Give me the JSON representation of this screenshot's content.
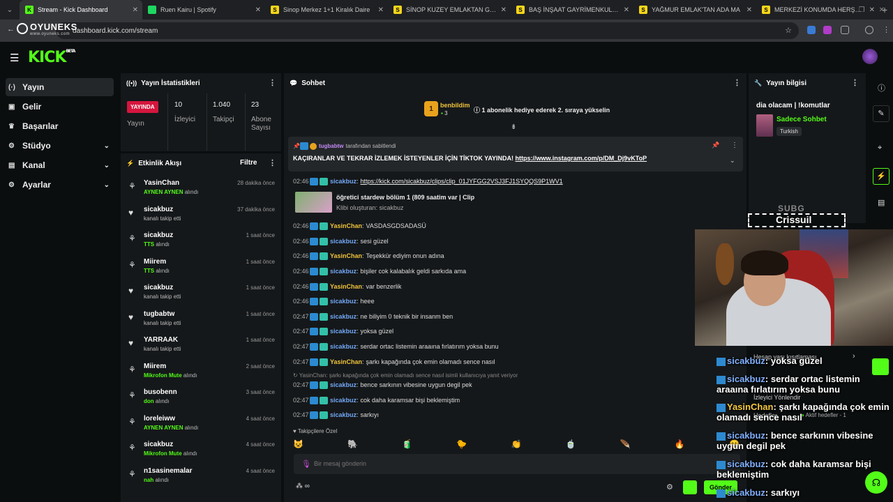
{
  "browser": {
    "tabs": [
      {
        "label": "Stream - Kick Dashboard",
        "color": "#53fc18",
        "glyph": "K",
        "active": true
      },
      {
        "label": "Ruen Kairu | Spotify",
        "color": "#1ed760",
        "glyph": "",
        "active": false
      },
      {
        "label": "Sinop Merkez 1+1 Kiralık Daire",
        "color": "#f5d51a",
        "glyph": "S",
        "active": false
      },
      {
        "label": "SİNOP KUZEY EMLAKTAN GELİ",
        "color": "#f5d51a",
        "glyph": "S",
        "active": false
      },
      {
        "label": "BAŞ İNŞAAT GAYRİMENKUL'DE",
        "color": "#f5d51a",
        "glyph": "S",
        "active": false
      },
      {
        "label": "YAĞMUR EMLAK'TAN ADA MA",
        "color": "#f5d51a",
        "glyph": "S",
        "active": false
      },
      {
        "label": "MERKEZİ KONUMDA HERŞEY D",
        "color": "#f5d51a",
        "glyph": "S",
        "active": false
      }
    ],
    "url": "dashboard.kick.com/stream",
    "overlay_logo": "OYUNEKS",
    "overlay_logo_sub": "www.oyuneks.com"
  },
  "sidebar": {
    "items": [
      {
        "label": "Yayın",
        "icon": "broadcast-icon",
        "glyph": "(·)",
        "active": true,
        "chevron": false
      },
      {
        "label": "Gelir",
        "icon": "wallet-icon",
        "glyph": "▣",
        "active": false,
        "chevron": false
      },
      {
        "label": "Başarılar",
        "icon": "trophy-icon",
        "glyph": "♛",
        "active": false,
        "chevron": false
      },
      {
        "label": "Stüdyo",
        "icon": "studio-icon",
        "glyph": "⚙",
        "active": false,
        "chevron": true
      },
      {
        "label": "Kanal",
        "icon": "channel-icon",
        "glyph": "▤",
        "active": false,
        "chevron": true
      },
      {
        "label": "Ayarlar",
        "icon": "settings-icon",
        "glyph": "⚙",
        "active": false,
        "chevron": true
      }
    ]
  },
  "stats": {
    "title": "Yayın İstatistikleri",
    "live_badge": "YAYINDA",
    "yayin_label": "Yayın",
    "viewers_value": "10",
    "viewers_label": "İzleyici",
    "followers_value": "1.040",
    "followers_label": "Takipçi",
    "subs_value": "23",
    "subs_label": "Abone Sayısı"
  },
  "activity": {
    "title": "Etkinlik Akışı",
    "filter_label": "Filtre",
    "items": [
      {
        "name": "YasinChan",
        "detail_highlight": "AYNEN AYNEN",
        "detail": " alındı",
        "time": "28 dakika önce",
        "icon": "reward-icon"
      },
      {
        "name": "sicakbuz",
        "detail_highlight": "",
        "detail": "kanalı takip etti",
        "time": "37 dakika önce",
        "icon": "heart-icon"
      },
      {
        "name": "sicakbuz",
        "detail_highlight": "TTS",
        "detail": " alındı",
        "time": "1 saat önce",
        "icon": "reward-icon"
      },
      {
        "name": "Miirem",
        "detail_highlight": "TTS",
        "detail": " alındı",
        "time": "1 saat önce",
        "icon": "reward-icon"
      },
      {
        "name": "sicakbuz",
        "detail_highlight": "",
        "detail": "kanalı takip etti",
        "time": "1 saat önce",
        "icon": "heart-icon"
      },
      {
        "name": "tugbabtw",
        "detail_highlight": "",
        "detail": "kanalı takip etti",
        "time": "1 saat önce",
        "icon": "heart-icon"
      },
      {
        "name": "YARRAAK",
        "detail_highlight": "",
        "detail": "kanalı takip etti",
        "time": "1 saat önce",
        "icon": "heart-icon"
      },
      {
        "name": "Miirem",
        "detail_highlight": "Mikrofon Mute",
        "detail": " alındı",
        "time": "2 saat önce",
        "icon": "reward-icon"
      },
      {
        "name": "busobenn",
        "detail_highlight": "don",
        "detail": " alındı",
        "time": "3 saat önce",
        "icon": "reward-icon"
      },
      {
        "name": "loreleiww",
        "detail_highlight": "AYNEN AYNEN",
        "detail": " alındı",
        "time": "4 saat önce",
        "icon": "reward-icon"
      },
      {
        "name": "sicakbuz",
        "detail_highlight": "Mikrofon Mute",
        "detail": " alındı",
        "time": "4 saat önce",
        "icon": "reward-icon"
      },
      {
        "name": "n1sasinemalar",
        "detail_highlight": "nah",
        "detail": " alındı",
        "time": "4 saat önce",
        "icon": "reward-icon"
      }
    ]
  },
  "chat": {
    "title": "Sohbet",
    "leader_name": "benbildim",
    "leader_count": "3",
    "leader_msg": "1 abonelik hediye ederek 2. sıraya yükselin",
    "pinned_by": "tugbabtw",
    "pinned_suffix": "tarafından sabitlendi",
    "pinned_text": "KAÇIRANLAR VE TEKRAR İZLEMEK İSTEYENLER İÇİN TİKTOK YAYINDA!",
    "pinned_link": "https://www.instagram.com/p/DM_Dj9vKToP",
    "clip_title": "öğretici stardew bölüm 1 (809 saatim var | Clip",
    "clip_sub": "Klibi oluşturan: sicakbuz",
    "reply_hint": "YasinChan: şarkı kapağında çok emin olamadı sence nasıl isimli kullanıcıya yanıt veriyor",
    "messages": [
      {
        "time": "02:46",
        "user": "sicakbuz",
        "text": "https://kick.com/sicakbuz/clips/clip_01JYFGG2VSJ3FJ1SYQQS9P1WV1",
        "link": true
      },
      {
        "time": "02:46",
        "user": "YasinChan",
        "text": "VASDASGDSADASÜ"
      },
      {
        "time": "02:46",
        "user": "sicakbuz",
        "text": "sesi güzel"
      },
      {
        "time": "02:46",
        "user": "YasinChan",
        "text": "Teşekkür ediyim onun adına"
      },
      {
        "time": "02:46",
        "user": "sicakbuz",
        "text": "bişiler cok kalabalık geldi sarkıda ama"
      },
      {
        "time": "02:46",
        "user": "YasinChan",
        "text": "var benzerlik"
      },
      {
        "time": "02:46",
        "user": "sicakbuz",
        "text": "heee"
      },
      {
        "time": "02:47",
        "user": "sicakbuz",
        "text": "ne biliyim 0 teknik bir insanm ben"
      },
      {
        "time": "02:47",
        "user": "sicakbuz",
        "text": "yoksa güzel"
      },
      {
        "time": "02:47",
        "user": "sicakbuz",
        "text": "serdar ortac listemin araaına fırlatırım yoksa bunu"
      },
      {
        "time": "02:47",
        "user": "YasinChan",
        "text": "şarkı kapağında çok emin olamadı sence nasıl"
      },
      {
        "time": "02:47",
        "user": "sicakbuz",
        "text": "bence sarkının vibesine uygun degil pek"
      },
      {
        "time": "02:47",
        "user": "sicakbuz",
        "text": "cok daha karamsar bişi beklemiştim"
      },
      {
        "time": "02:47",
        "user": "sicakbuz",
        "text": "sarkıyı"
      }
    ],
    "followers_only": "Takipçilere Özel",
    "input_placeholder": "Bir mesaj gönderin",
    "send_label": "Gönder"
  },
  "info": {
    "title": "Yayın bilgisi",
    "stream_title": "dia olacam | !komutlar",
    "category": "Sadece Sohbet",
    "language": "Turkish",
    "restrictions": "Hesap yaşı kısıtlaması",
    "viewer_redirect": "İzleyici Yönlendir",
    "goals": "Hedefler",
    "active_goals": "Aktif hedefler - 1"
  },
  "overlay": {
    "brand_top": "SUBG",
    "brand_name": "Crissuil",
    "lines": [
      {
        "user": "sicakbuz",
        "text": ": yoksa güzel",
        "color": "blue"
      },
      {
        "user": "sicakbuz",
        "text": ": serdar ortac listemin",
        "color": "blue"
      },
      {
        "user": "",
        "text": "araaına fırlatırım yoksa bunu",
        "color": "blue"
      },
      {
        "user": "YasinChan",
        "text": ": şarkı kapağında çok emin",
        "color": "yellow"
      },
      {
        "user": "",
        "text": "olamadı sence nasıl",
        "color": "yellow"
      },
      {
        "user": "sicakbuz",
        "text": ": bence sarkının vibesine",
        "color": "blue"
      },
      {
        "user": "",
        "text": "uygun degil pek",
        "color": "blue"
      },
      {
        "user": "sicakbuz",
        "text": ": cok daha karamsar bişi",
        "color": "blue"
      },
      {
        "user": "",
        "text": "beklemiştim",
        "color": "blue"
      },
      {
        "user": "sicakbuz",
        "text": ": sarkıyı",
        "color": "blue"
      }
    ]
  },
  "colors": {
    "accent": "#53fc18",
    "live": "#d5163e",
    "blue_user": "#72a8f7",
    "yellow_user": "#f0c33c"
  }
}
